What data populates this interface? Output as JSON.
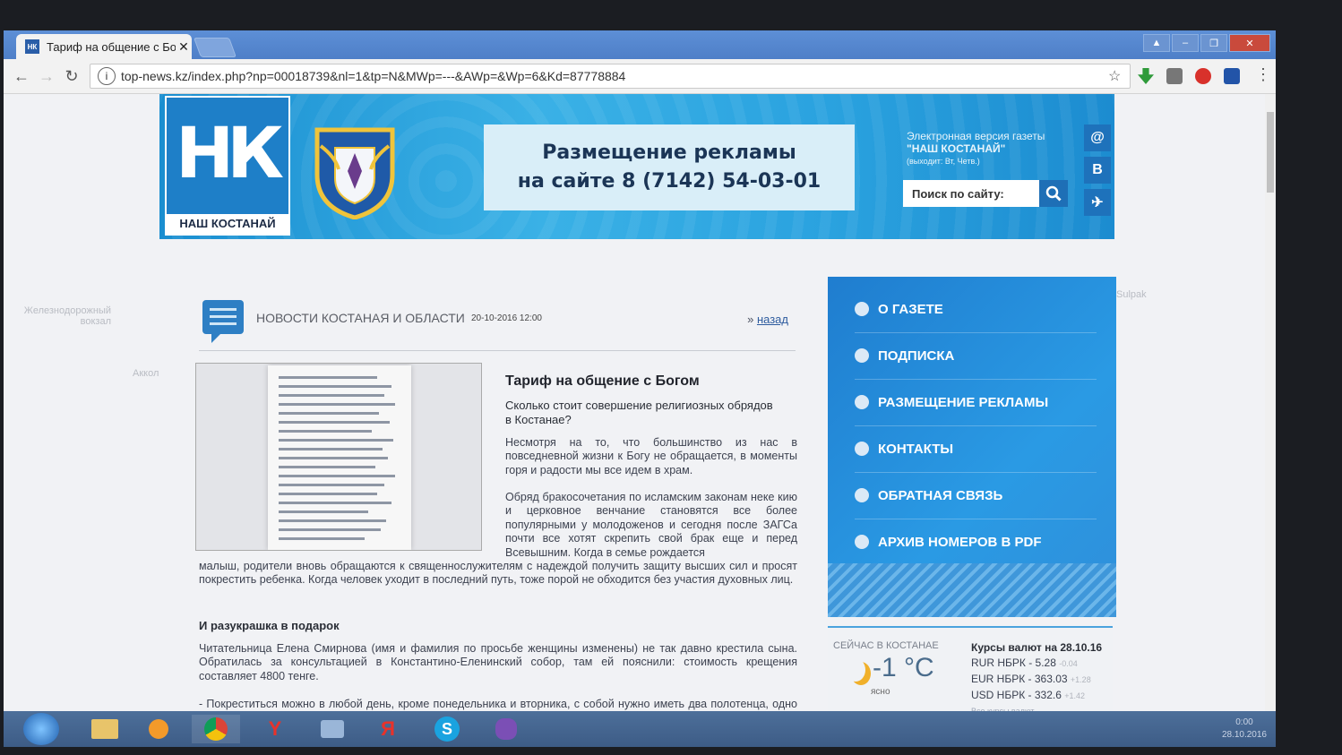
{
  "browser": {
    "tab_title": "Тариф на общение с Бо",
    "url": "top-news.kz/index.php?np=00018739&nl=1&tp=N&MWp=---&AWp=&Wp=6&Kd=87778884"
  },
  "header": {
    "logo_letters": "НК",
    "logo_caption": "НАШ КОСТАНАЙ",
    "ad_line1": "Размещение рекламы",
    "ad_line2": "на сайте 8 (7142) 54-03-01",
    "edition_line1": "Электронная версия газеты",
    "edition_line2": "\"НАШ КОСТАНАЙ\"",
    "edition_line3": "(выходит: Вт, Четв.)",
    "search_placeholder": "Поиск по сайту:",
    "social": [
      "@",
      "В",
      "✈"
    ]
  },
  "map_labels": [
    "Железнодорожный вокзал",
    "Аккол",
    "Sulpak"
  ],
  "category": {
    "title": "НОВОСТИ КОСТАНАЯ И ОБЛАСТИ",
    "date": "20-10-2016 12:00",
    "back_prefix": "»",
    "back_label": "назад"
  },
  "article": {
    "title": "Тариф на общение с Богом",
    "subtitle": "Сколько стоит совершение религиозных обрядов в Костанае?",
    "p1": "Несмотря на то, что большинство из нас в повседневной жизни к Богу не обращается, в моменты горя и радости мы все идем в храм.",
    "p2a": "Обряд бракосочетания по исламским законам неке кию и церковное венчание становятся все более популярными у молодоженов и сегодня после ЗАГСа почти все хотят скрепить свой брак еще и перед Всевышним. Когда в семье рождается",
    "p2b": "малыш, родители вновь обращаются к священнослужителям с надеждой получить защиту высших сил и просят покрестить ребенка. Когда человек уходит в последний путь, тоже порой не обходится без участия духовных лиц.",
    "heading": "И разукрашка в подарок",
    "p3": "Читательница Елена Смирнова (имя и фамилия по просьбе женщины изменены) не так давно крестила сына. Обратилась за консультацией в Константино-Еленинский собор, там ей пояснили: стоимость крещения составляет 4800 тенге.",
    "p4": "- Покреститься можно в любой день, кроме понедельника и вторника, с собой нужно иметь два полотенца, одно из них для ребенка, второе – жертвенное в храм, - рассказывает Елена. - Я сначала думала, что 4 800 тенге – это цена за услугу, но нам вручили пакет, в котором были крестик на"
  },
  "menu": {
    "items": [
      "О ГАЗЕТЕ",
      "ПОДПИСКА",
      "РАЗМЕЩЕНИЕ РЕКЛАМЫ",
      "КОНТАКТЫ",
      "ОБРАТНАЯ СВЯЗЬ",
      "АРХИВ НОМЕРОВ В PDF"
    ]
  },
  "weather": {
    "title": "СЕЙЧАС В КОСТАНАЕ",
    "temp": "-1 °C",
    "condition": "ясно"
  },
  "rates": {
    "title": "Курсы валют на 28.10.16",
    "rows": [
      {
        "label": "RUR НБРК - 5.28",
        "change": "-0.04"
      },
      {
        "label": "EUR НБРК - 363.03",
        "change": "+1.28"
      },
      {
        "label": "USD НБРК - 332.6",
        "change": "+1.42"
      }
    ],
    "all_link": "Все курсы валют"
  },
  "taskbar": {
    "apps": [
      "folder-icon",
      "media-icon",
      "chrome-icon",
      "yandex-browser-icon",
      "network-icon",
      "yandex-icon",
      "skype-icon",
      "viber-icon"
    ],
    "tray_time": "0:00",
    "tray_date": "28.10.2016"
  },
  "colors": {
    "brand_blue": "#1e7fc8",
    "menu_blue": "#2a9ae4",
    "tab_strip": "#5d8fd6"
  }
}
